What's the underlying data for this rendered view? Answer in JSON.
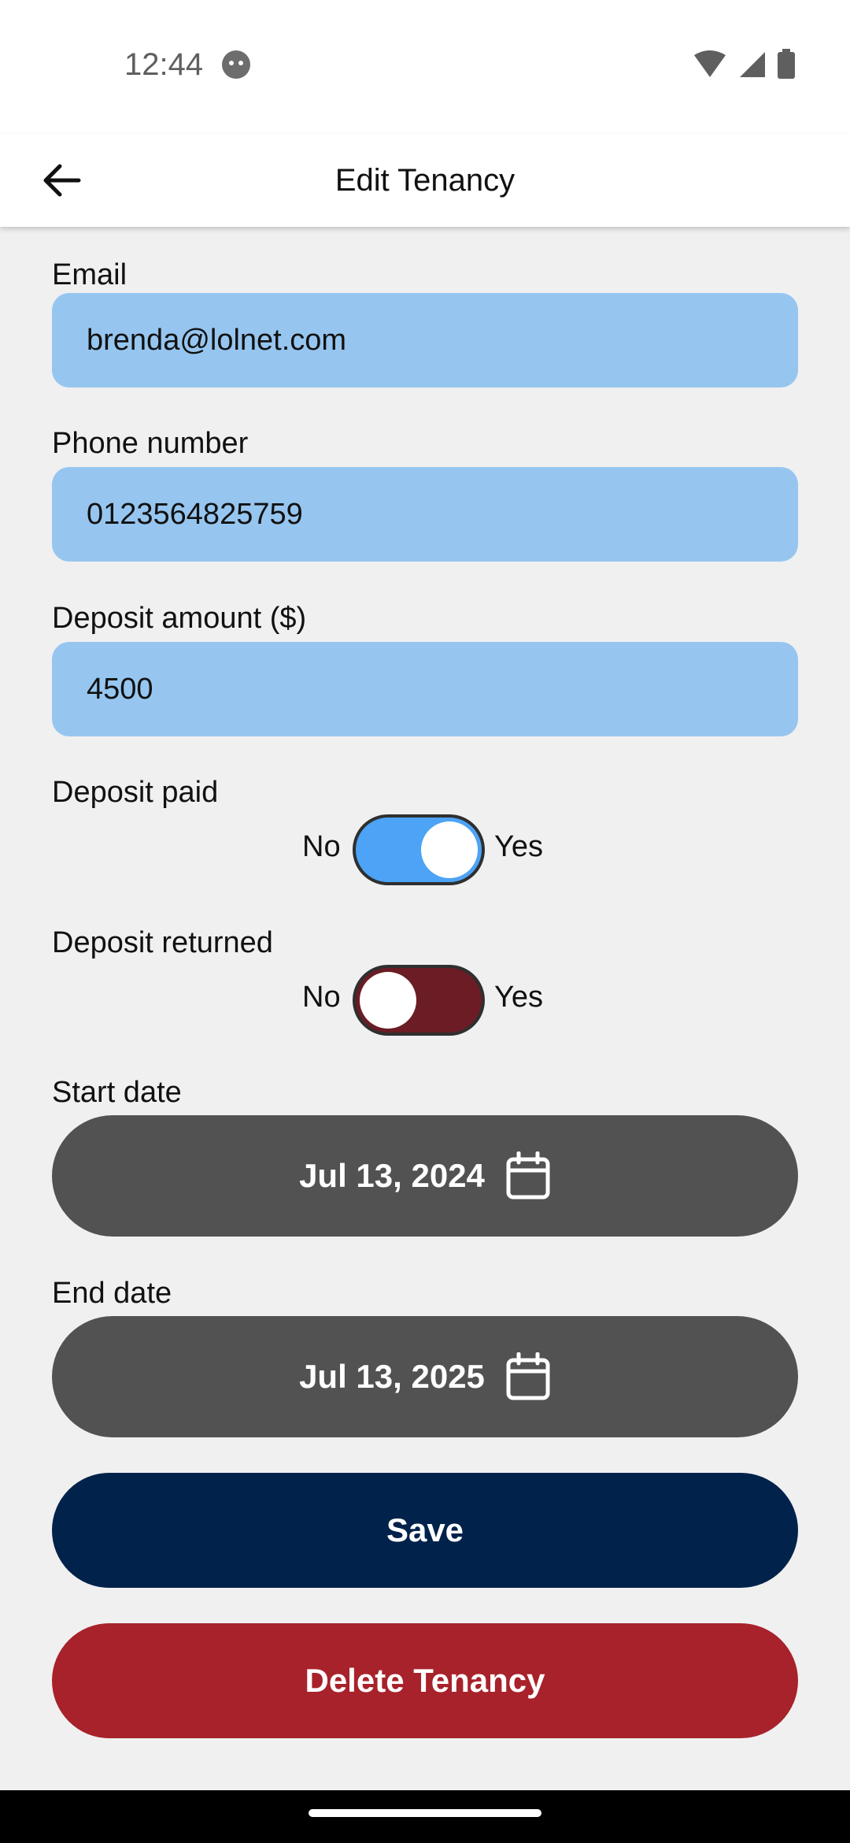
{
  "status_bar": {
    "time": "12:44"
  },
  "app_bar": {
    "title": "Edit Tenancy"
  },
  "form": {
    "email": {
      "label": "Email",
      "value": "brenda@lolnet.com"
    },
    "phone": {
      "label": "Phone number",
      "value": "0123564825759"
    },
    "deposit_amount": {
      "label": "Deposit amount ($)",
      "value": "4500"
    },
    "deposit_paid": {
      "label": "Deposit paid",
      "no": "No",
      "yes": "Yes",
      "state": "on"
    },
    "deposit_returned": {
      "label": "Deposit returned",
      "no": "No",
      "yes": "Yes",
      "state": "off"
    },
    "start_date": {
      "label": "Start date",
      "value": "Jul 13, 2024"
    },
    "end_date": {
      "label": "End date",
      "value": "Jul 13, 2025"
    }
  },
  "actions": {
    "save": "Save",
    "delete": "Delete Tenancy"
  },
  "colors": {
    "field_bg": "#96c6f0",
    "toggle_on": "#4da3f5",
    "toggle_off": "#6b1c24",
    "date_button": "#525252",
    "save_button": "#00224b",
    "delete_button": "#a8222b"
  }
}
